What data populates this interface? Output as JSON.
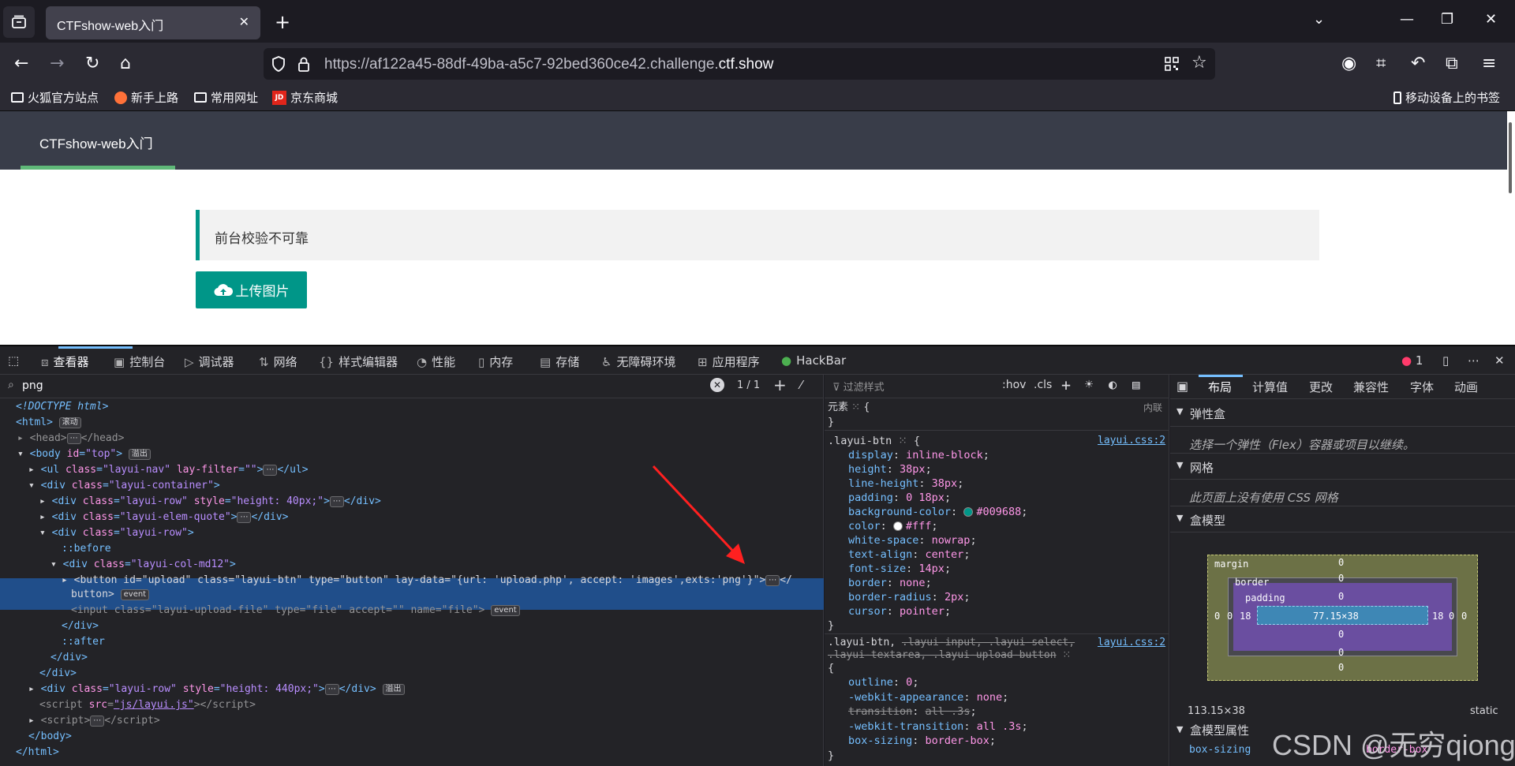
{
  "browser": {
    "tab_title": "CTFshow-web入门",
    "url_prefix": "https://af122a45-88df-49ba-a5c7-92bed360ce42.challenge.",
    "url_domain": "ctf.show",
    "bookmarks": [
      "火狐官方站点",
      "新手上路",
      "常用网址",
      "京东商城"
    ],
    "mobile_bookmarks": "移动设备上的书签"
  },
  "page": {
    "nav_item": "CTFshow-web入门",
    "quote": "前台校验不可靠",
    "upload_label": "上传图片"
  },
  "devtools": {
    "tabs": [
      "查看器",
      "控制台",
      "调试器",
      "网络",
      "样式编辑器",
      "性能",
      "内存",
      "存储",
      "无障碍环境",
      "应用程序",
      "HackBar"
    ],
    "error_count": "1",
    "search_value": "png",
    "search_count": "1 / 1",
    "filter_placeholder": "过滤样式",
    "hov": ":hov",
    "cls": ".cls",
    "element_label": "元素",
    "inline_label": "内联",
    "layout_tabs": [
      "布局",
      "计算值",
      "更改",
      "兼容性",
      "字体",
      "动画"
    ],
    "flex_title": "弹性盒",
    "flex_note": "选择一个弹性（Flex）容器或项目以继续。",
    "grid_title": "网格",
    "grid_note": "此页面上没有使用 CSS 网格",
    "boxmodel_title": "盒模型",
    "box_margin_label": "margin",
    "box_border_label": "border",
    "box_padding_label": "padding",
    "box_content": "77.15×38",
    "box_zero": "0",
    "box_eighteen": "18",
    "box_dimensions": "113.15×38",
    "box_position": "static",
    "boxprops_title": "盒模型属性",
    "boxprop_name": "box-sizing",
    "boxprop_value": "border-box",
    "rule1_selector": ".layui-btn",
    "rule_source": "layui.css:2",
    "rule1_props": [
      [
        "display",
        "inline-block"
      ],
      [
        "height",
        "38px"
      ],
      [
        "line-height",
        "38px"
      ],
      [
        "padding",
        "0 18px"
      ],
      [
        "background-color",
        "#009688"
      ],
      [
        "color",
        "#fff"
      ],
      [
        "white-space",
        "nowrap"
      ],
      [
        "text-align",
        "center"
      ],
      [
        "font-size",
        "14px"
      ],
      [
        "border",
        "none"
      ],
      [
        "border-radius",
        "2px"
      ],
      [
        "cursor",
        "pointer"
      ]
    ],
    "rule2_selector_a": ".layui-btn, ",
    "rule2_selector_b": ".layui-input, .layui-select,",
    "rule2_selector_c": ".layui-textarea, .layui-upload-button",
    "rule2_props": [
      [
        "outline",
        "0"
      ],
      [
        "-webkit-appearance",
        "none"
      ],
      [
        "transition",
        "all .3s"
      ],
      [
        "-webkit-transition",
        "all .3s"
      ],
      [
        "box-sizing",
        "border-box"
      ]
    ],
    "badge_scroll": "滚动",
    "badge_overflow": "溢出",
    "badge_event": "event"
  },
  "watermark": "CSDN @无穷qiong",
  "colors": {
    "accent": "#009688",
    "nav_accent": "#5fb878",
    "devtools_bg": "#232327"
  }
}
